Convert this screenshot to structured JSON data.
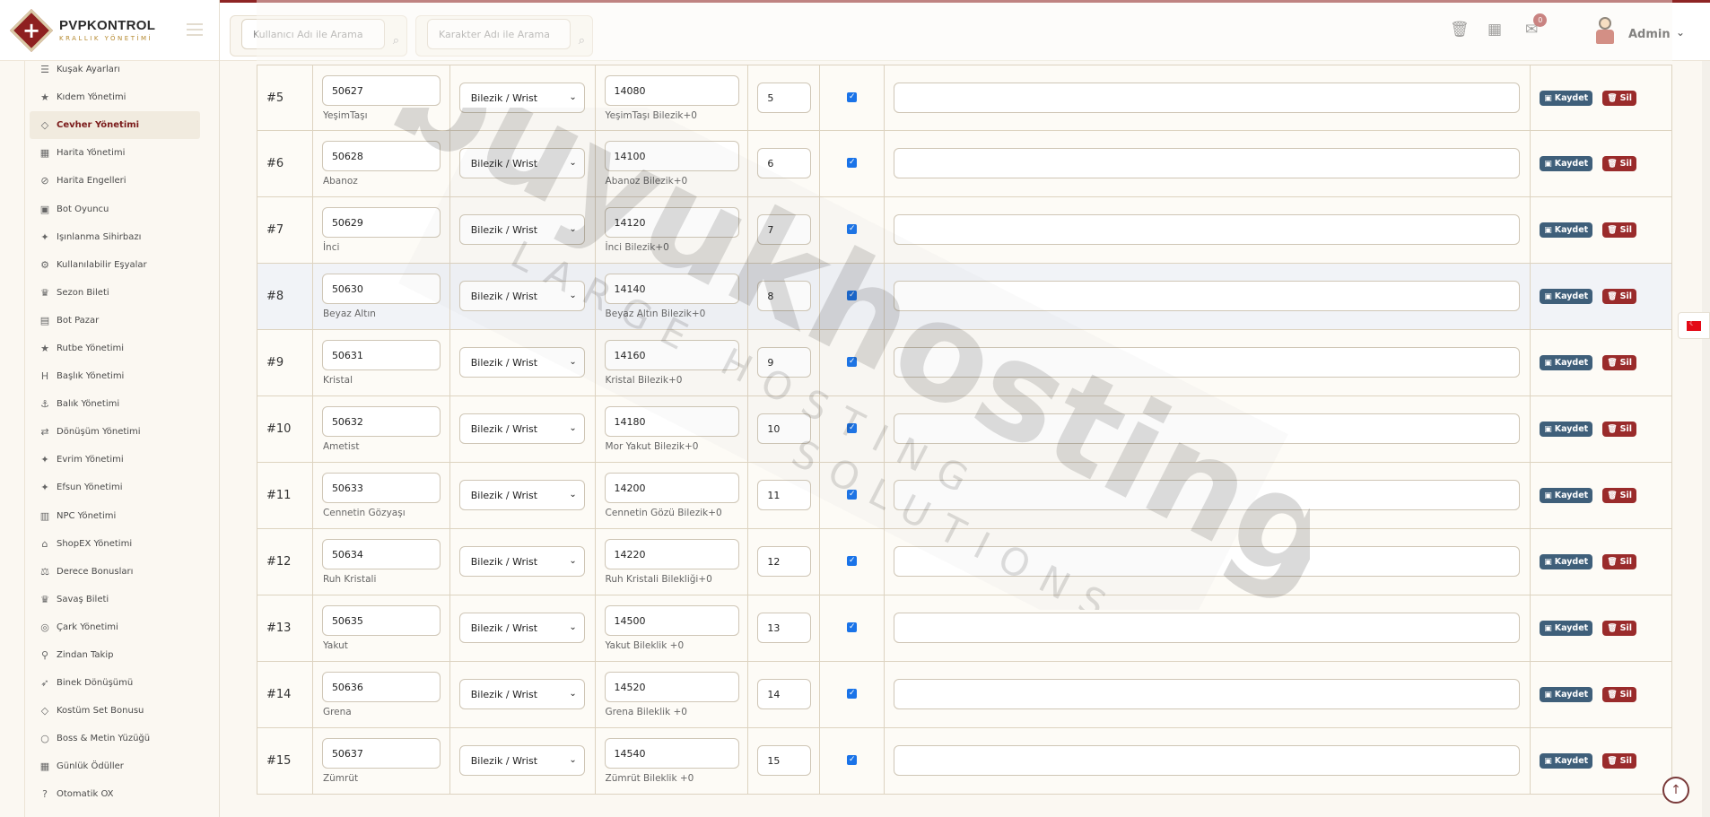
{
  "brand": {
    "title": "PVPKONTROL",
    "subtitle": "KRALLIK YÖNETİMİ"
  },
  "search": {
    "user_placeholder": "Kullanıcı Adı ile Arama",
    "char_placeholder": "Karakter Adı ile Arama"
  },
  "header": {
    "notification_count": "0",
    "admin_name": "Admin"
  },
  "sidebar": {
    "items": [
      {
        "label": "Kuşak Ayarları",
        "icon": "sliders-icon",
        "glyph": "☰"
      },
      {
        "label": "Kıdem Yönetimi",
        "icon": "star-icon",
        "glyph": "★"
      },
      {
        "label": "Cevher Yönetimi",
        "icon": "gem-icon",
        "glyph": "◇",
        "active": true
      },
      {
        "label": "Harita Yönetimi",
        "icon": "map-icon",
        "glyph": "▦"
      },
      {
        "label": "Harita Engelleri",
        "icon": "ban-icon",
        "glyph": "⊘"
      },
      {
        "label": "Bot Oyuncu",
        "icon": "robot-icon",
        "glyph": "▣"
      },
      {
        "label": "Işınlanma Sihirbazı",
        "icon": "wand-icon",
        "glyph": "✦"
      },
      {
        "label": "Kullanılabilir Eşyalar",
        "icon": "cogs-icon",
        "glyph": "⚙"
      },
      {
        "label": "Sezon Bileti",
        "icon": "trophy-icon",
        "glyph": "♛"
      },
      {
        "label": "Bot Pazar",
        "icon": "store-icon",
        "glyph": "▤"
      },
      {
        "label": "Rutbe Yönetimi",
        "icon": "star-icon",
        "glyph": "★"
      },
      {
        "label": "Başlık Yönetimi",
        "icon": "heading-icon",
        "glyph": "H"
      },
      {
        "label": "Balık Yönetimi",
        "icon": "anchor-icon",
        "glyph": "⚓"
      },
      {
        "label": "Dönüşüm Yönetimi",
        "icon": "shuffle-icon",
        "glyph": "⇄"
      },
      {
        "label": "Evrim Yönetimi",
        "icon": "wand-icon",
        "glyph": "✦"
      },
      {
        "label": "Efsun Yönetimi",
        "icon": "wand-icon",
        "glyph": "✦"
      },
      {
        "label": "NPC Yönetimi",
        "icon": "building-icon",
        "glyph": "▥"
      },
      {
        "label": "ShopEX Yönetimi",
        "icon": "shop-icon",
        "glyph": "⌂"
      },
      {
        "label": "Derece Bonusları",
        "icon": "balance-icon",
        "glyph": "⚖"
      },
      {
        "label": "Savaş Bileti",
        "icon": "trophy-icon",
        "glyph": "♛"
      },
      {
        "label": "Çark Yönetimi",
        "icon": "wheel-icon",
        "glyph": "◎"
      },
      {
        "label": "Zindan Takip",
        "icon": "pin-icon",
        "glyph": "⚲"
      },
      {
        "label": "Binek Dönüşümü",
        "icon": "rocket-icon",
        "glyph": "➶"
      },
      {
        "label": "Kostüm Set Bonusu",
        "icon": "gem-icon",
        "glyph": "◇"
      },
      {
        "label": "Boss & Metin Yüzüğü",
        "icon": "circle-icon",
        "glyph": "○"
      },
      {
        "label": "Günlük Ödüller",
        "icon": "calendar-icon",
        "glyph": "▦"
      },
      {
        "label": "Otomatik OX",
        "icon": "question-icon",
        "glyph": "?"
      }
    ]
  },
  "table": {
    "type_option": "Bilezik / Wrist",
    "save_label": "Kaydet",
    "delete_label": "Sil",
    "rows": [
      {
        "num": "#5",
        "vnum": "50627",
        "vname": "YeşimTaşı",
        "item": "14080",
        "item_name": "YeşimTaşı Bilezik+0",
        "order": "5"
      },
      {
        "num": "#6",
        "vnum": "50628",
        "vname": "Abanoz",
        "item": "14100",
        "item_name": "Abanoz Bilezik+0",
        "order": "6"
      },
      {
        "num": "#7",
        "vnum": "50629",
        "vname": "İnci",
        "item": "14120",
        "item_name": "İnci Bilezik+0",
        "order": "7"
      },
      {
        "num": "#8",
        "vnum": "50630",
        "vname": "Beyaz Altın",
        "item": "14140",
        "item_name": "Beyaz Altın Bilezik+0",
        "order": "8",
        "highlight": true
      },
      {
        "num": "#9",
        "vnum": "50631",
        "vname": "Kristal",
        "item": "14160",
        "item_name": "Kristal Bilezik+0",
        "order": "9"
      },
      {
        "num": "#10",
        "vnum": "50632",
        "vname": "Ametist",
        "item": "14180",
        "item_name": "Mor Yakut Bilezik+0",
        "order": "10"
      },
      {
        "num": "#11",
        "vnum": "50633",
        "vname": "Cennetin Gözyaşı",
        "item": "14200",
        "item_name": "Cennetin Gözü Bilezik+0",
        "order": "11"
      },
      {
        "num": "#12",
        "vnum": "50634",
        "vname": "Ruh Kristali",
        "item": "14220",
        "item_name": "Ruh Kristali Bilekliği+0",
        "order": "12"
      },
      {
        "num": "#13",
        "vnum": "50635",
        "vname": "Yakut",
        "item": "14500",
        "item_name": "Yakut Bileklik +0",
        "order": "13"
      },
      {
        "num": "#14",
        "vnum": "50636",
        "vname": "Grena",
        "item": "14520",
        "item_name": "Grena Bileklik +0",
        "order": "14"
      },
      {
        "num": "#15",
        "vnum": "50637",
        "vname": "Zümrüt",
        "item": "14540",
        "item_name": "Zümrüt Bileklik +0",
        "order": "15"
      }
    ]
  },
  "watermark": {
    "main": "buyukhosting",
    "line1": "LARGE HOSTING",
    "line2": "SOLUTIONS"
  },
  "colors": {
    "brand_red": "#8e2424",
    "save_btn": "#3f5f7a",
    "delete_btn": "#9a2b2b",
    "checkbox": "#1a73e8"
  }
}
